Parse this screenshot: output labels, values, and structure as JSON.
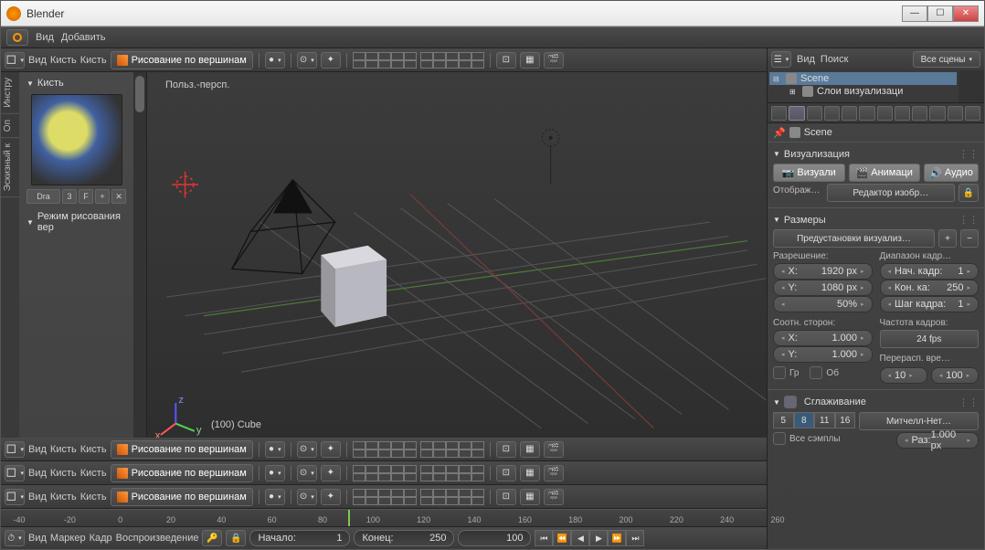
{
  "window": {
    "title": "Blender"
  },
  "winbtns": {
    "min": "—",
    "max": "☐",
    "close": "✕"
  },
  "info": {
    "view": "Вид",
    "add": "Добавить"
  },
  "view3d": {
    "menu_view": "Вид",
    "menu_brush": "Кисть",
    "menu_brush2": "Кисть",
    "mode": "Рисование по вершинам",
    "perspective_label": "Польз.-персп.",
    "object_label": "(100) Cube"
  },
  "tool": {
    "tabs": [
      "Инстру",
      "Оп",
      "Эскизный к"
    ],
    "brush_header": "Кисть",
    "draw": "Dra",
    "n3": "3",
    "f": "F",
    "mode_header": "Режим рисования вер"
  },
  "outliner": {
    "menu_view": "Вид",
    "menu_search": "Поиск",
    "scene_dd": "Все сцены",
    "items": [
      {
        "label": "Scene",
        "indent": 0,
        "exp": "⊟",
        "sel": true
      },
      {
        "label": "Слои визуализаци",
        "indent": 1,
        "exp": "⊞",
        "sel": false
      }
    ]
  },
  "props": {
    "breadcrumb": "Scene",
    "panel_render": "Визуализация",
    "btn_render": "Визуали",
    "btn_anim": "Анимаци",
    "btn_audio": "Аудио",
    "display_label": "Отображ…",
    "display_val": "Редактор изобр…",
    "panel_dims": "Размеры",
    "preset": "Предустановки визуализ…",
    "res_label": "Разрешение:",
    "res_x": "X:",
    "res_x_val": "1920 px",
    "res_y": "Y:",
    "res_y_val": "1080 px",
    "res_pct": "50%",
    "range_label": "Диапазон кадр…",
    "start_l": "Нач. кадр:",
    "start_v": "1",
    "end_l": "Кон. ка:",
    "end_v": "250",
    "step_l": "Шаг кадра:",
    "step_v": "1",
    "aspect_label": "Соотн. сторон:",
    "asp_x": "X:",
    "asp_x_v": "1.000",
    "asp_y": "Y:",
    "asp_y_v": "1.000",
    "fps_label": "Частота кадров:",
    "fps_val": "24 fps",
    "remap": "Перерасп. вре…",
    "border": "Гр",
    "crop": "Об",
    "old": "10",
    "new": "100",
    "aa_header": "Сглаживание",
    "aa_samples": [
      "5",
      "8",
      "11",
      "16"
    ],
    "aa_active": "8",
    "aa_filter": "Митчелл-Нет…",
    "full_sample": "Все сэмплы",
    "size_l": "Раз:",
    "size_v": "1.000 px"
  },
  "timeline": {
    "ticks": [
      "-40",
      "-20",
      "0",
      "20",
      "40",
      "60",
      "80",
      "100",
      "120",
      "140",
      "160",
      "180",
      "200",
      "220",
      "240",
      "260"
    ],
    "menu_view": "Вид",
    "menu_marker": "Маркер",
    "menu_frame": "Кадр",
    "menu_play": "Воспроизведение",
    "start_l": "Начало:",
    "start_v": "1",
    "end_l": "Конец:",
    "end_v": "250",
    "cur_v": "100"
  },
  "play": {
    "first": "⏮",
    "prevkey": "⏪",
    "prev": "◀",
    "rplay": "◀",
    "play": "▶",
    "next": "▶",
    "nextkey": "⏩",
    "last": "⏭"
  }
}
